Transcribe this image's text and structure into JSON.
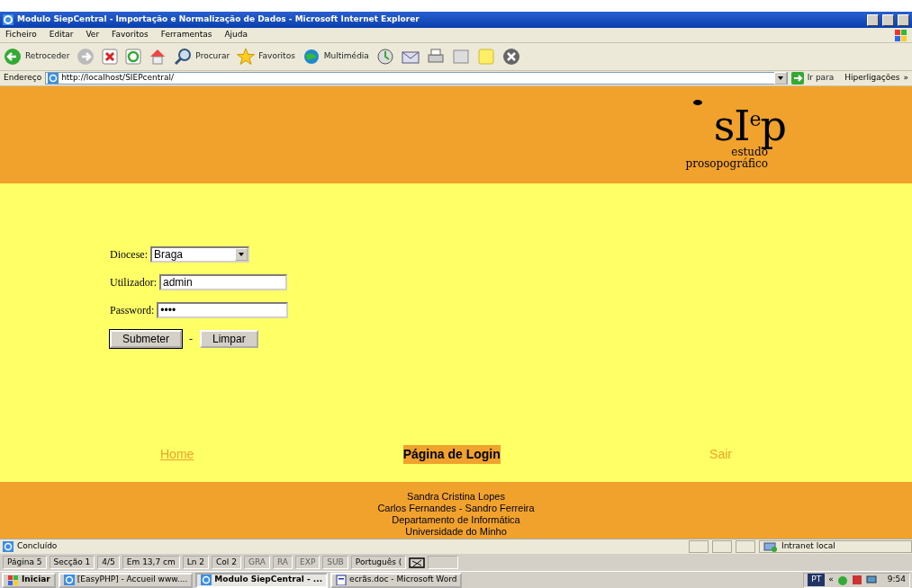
{
  "window": {
    "title": "Modulo SiepCentral - Importação e Normalização de Dados - Microsoft Internet Explorer"
  },
  "menu": [
    "Ficheiro",
    "Editar",
    "Ver",
    "Favoritos",
    "Ferramentas",
    "Ajuda"
  ],
  "toolbar": {
    "back": "Retroceder",
    "search": "Procurar",
    "favorites": "Favoritos",
    "media": "Multimédia"
  },
  "address_bar": {
    "label": "Endereço",
    "url": "http://localhost/SIEPcentral/",
    "go": "Ir para",
    "links": "Hiperligações",
    "more": "»"
  },
  "header": {
    "logo": "sI$^{e}$p",
    "logo_line_1": "estudo",
    "logo_line_2": "prosopográfico"
  },
  "form": {
    "fields": [
      {
        "kind": "select",
        "label": "Diocese:",
        "value": "Braga"
      },
      {
        "kind": "text",
        "label": "Utilizador:",
        "value": "admin"
      },
      {
        "kind": "password",
        "label": "Password:",
        "value": "••••"
      }
    ],
    "buttons": [
      "Submeter",
      "Limpar"
    ],
    "separator": "-"
  },
  "nav": [
    {
      "label": "Home",
      "selected": false
    },
    {
      "label": "Página de Login",
      "selected": true
    },
    {
      "label": "Sair",
      "selected": false
    }
  ],
  "footer": [
    "Sandra Cristina Lopes",
    "Carlos Fernandes - Sandro Ferreira",
    "Departamento de Informática",
    "Universidade do Minho"
  ],
  "status_bar": {
    "text": "Concluído",
    "zone": "Intranet local"
  },
  "word_status": {
    "items": [
      {
        "text": "Página 5",
        "disabled": false
      },
      {
        "text": "Secção 1",
        "disabled": false
      },
      {
        "text": "4/5",
        "disabled": false
      },
      {
        "text": "Em 13,7 cm",
        "disabled": false
      },
      {
        "text": "Ln 2",
        "disabled": false
      },
      {
        "text": "Col 2",
        "disabled": false
      },
      {
        "text": "GRA",
        "disabled": true
      },
      {
        "text": "RA",
        "disabled": true
      },
      {
        "text": "EXP",
        "disabled": true
      },
      {
        "text": "SUB",
        "disabled": true
      },
      {
        "text": "Português (",
        "disabled": false
      }
    ]
  },
  "taskbar": {
    "start": "Iniciar",
    "tasks": [
      {
        "label": "[EasyPHP] - Accueil www....",
        "selected": false
      },
      {
        "label": "Modulo SiepCentral - ...",
        "selected": true
      },
      {
        "label": "ecrãs.doc - Microsoft Word",
        "selected": false
      }
    ],
    "language": "PT",
    "more": "«",
    "clock": "9:54"
  }
}
